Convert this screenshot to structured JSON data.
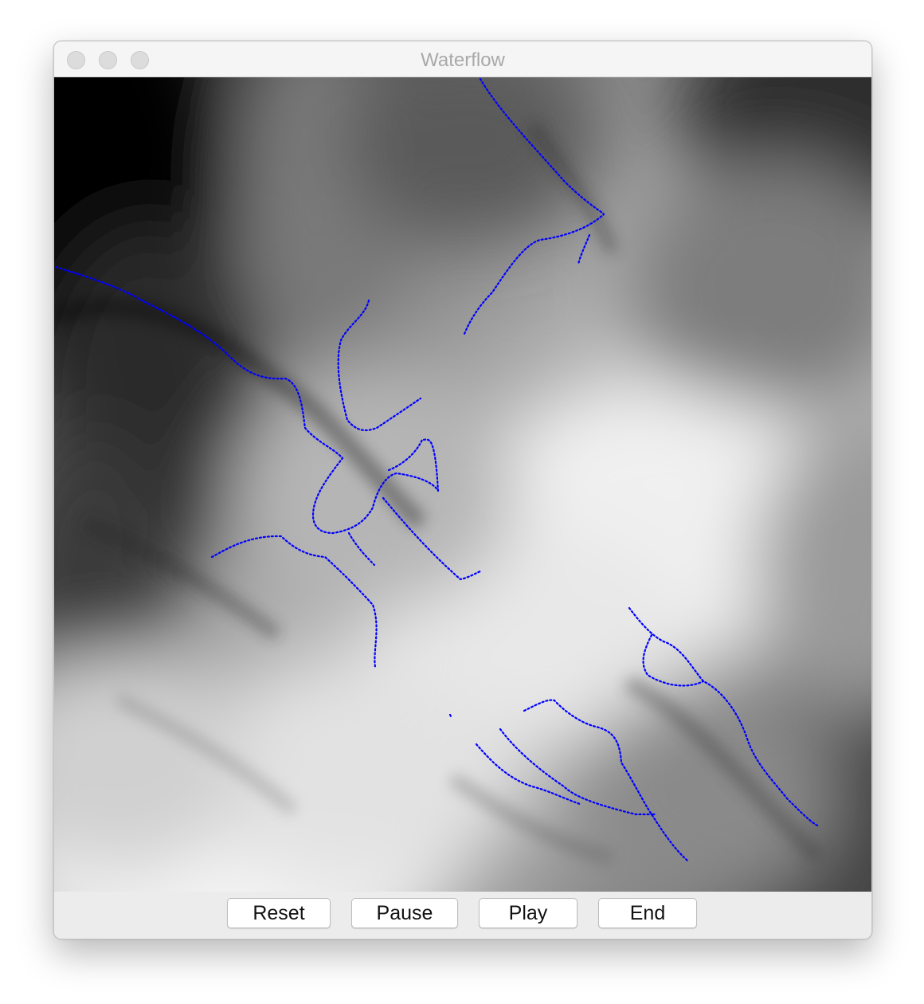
{
  "window": {
    "title": "Waterflow"
  },
  "controls": {
    "reset_label": "Reset",
    "pause_label": "Pause",
    "play_label": "Play",
    "end_label": "End"
  },
  "map": {
    "type": "grayscale-heightmap",
    "flow_color": "#0000ff"
  }
}
